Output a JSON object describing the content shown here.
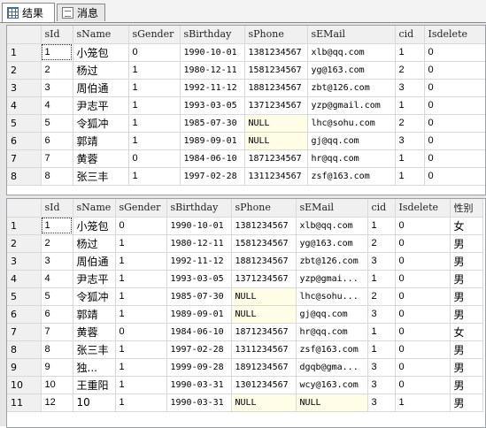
{
  "tabs": [
    {
      "label": "结果",
      "icon": "grid-icon"
    },
    {
      "label": "消息",
      "icon": "message-icon"
    }
  ],
  "grid1": {
    "columns": [
      "",
      "sId",
      "sName",
      "sGender",
      "sBirthday",
      "sPhone",
      "sEMail",
      "cid",
      "Isdelete"
    ],
    "rows": [
      [
        "1",
        "1",
        "小笼包",
        "0",
        "1990-10-01",
        "1381234567",
        "xlb@qq.com",
        "1",
        "0"
      ],
      [
        "2",
        "2",
        "杨过",
        "1",
        "1980-12-11",
        "1581234567",
        "yg@163.com",
        "2",
        "0"
      ],
      [
        "3",
        "3",
        "周伯通",
        "1",
        "1992-11-12",
        "1881234567",
        "zbt@126.com",
        "3",
        "0"
      ],
      [
        "4",
        "4",
        "尹志平",
        "1",
        "1993-03-05",
        "1371234567",
        "yzp@gmail.com",
        "1",
        "0"
      ],
      [
        "5",
        "5",
        "令狐冲",
        "1",
        "1985-07-30",
        "NULL",
        "lhc@sohu.com",
        "2",
        "0"
      ],
      [
        "6",
        "6",
        "郭靖",
        "1",
        "1989-09-01",
        "NULL",
        "gj@qq.com",
        "3",
        "0"
      ],
      [
        "7",
        "7",
        "黄蓉",
        "0",
        "1984-06-10",
        "1871234567",
        "hr@qq.com",
        "1",
        "0"
      ],
      [
        "8",
        "8",
        "张三丰",
        "1",
        "1997-02-28",
        "1311234567",
        "zsf@163.com",
        "1",
        "0"
      ]
    ]
  },
  "grid2": {
    "columns": [
      "",
      "sId",
      "sName",
      "sGender",
      "sBirthday",
      "sPhone",
      "sEMail",
      "cid",
      "Isdelete",
      "性别"
    ],
    "rows": [
      [
        "1",
        "1",
        "小笼包",
        "0",
        "1990-10-01",
        "1381234567",
        "xlb@qq.com",
        "1",
        "0",
        "女"
      ],
      [
        "2",
        "2",
        "杨过",
        "1",
        "1980-12-11",
        "1581234567",
        "yg@163.com",
        "2",
        "0",
        "男"
      ],
      [
        "3",
        "3",
        "周伯通",
        "1",
        "1992-11-12",
        "1881234567",
        "zbt@126.com",
        "3",
        "0",
        "男"
      ],
      [
        "4",
        "4",
        "尹志平",
        "1",
        "1993-03-05",
        "1371234567",
        "yzp@gmai...",
        "1",
        "0",
        "男"
      ],
      [
        "5",
        "5",
        "令狐冲",
        "1",
        "1985-07-30",
        "NULL",
        "lhc@sohu...",
        "2",
        "0",
        "男"
      ],
      [
        "6",
        "6",
        "郭靖",
        "1",
        "1989-09-01",
        "NULL",
        "gj@qq.com",
        "3",
        "0",
        "男"
      ],
      [
        "7",
        "7",
        "黄蓉",
        "0",
        "1984-06-10",
        "1871234567",
        "hr@qq.com",
        "1",
        "0",
        "女"
      ],
      [
        "8",
        "8",
        "张三丰",
        "1",
        "1997-02-28",
        "1311234567",
        "zsf@163.com",
        "1",
        "0",
        "男"
      ],
      [
        "9",
        "9",
        "独...",
        "1",
        "1999-09-28",
        "1891234567",
        "dgqb@gma...",
        "3",
        "0",
        "男"
      ],
      [
        "10",
        "10",
        "王重阳",
        "1",
        "1990-03-31",
        "1301234567",
        "wcy@163.com",
        "3",
        "0",
        "男"
      ],
      [
        "11",
        "12",
        "10",
        "1",
        "1990-03-31",
        "NULL",
        "NULL",
        "3",
        "1",
        "男"
      ]
    ]
  }
}
